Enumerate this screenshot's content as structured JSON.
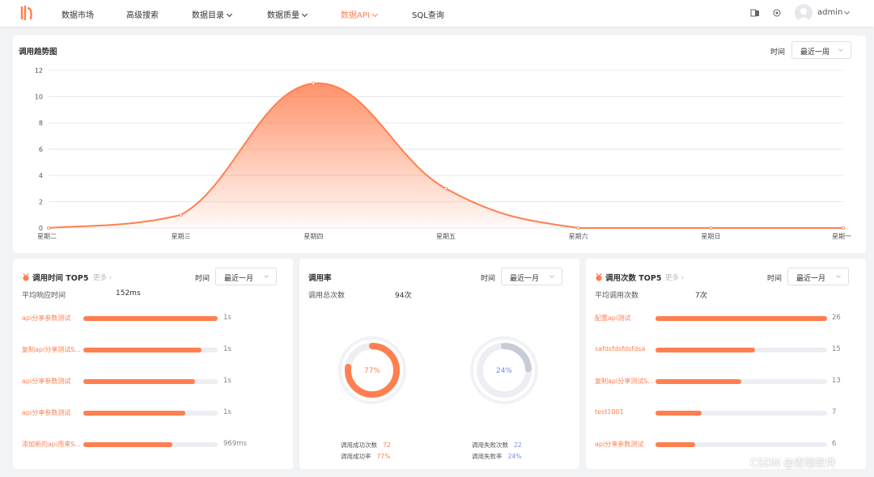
{
  "nav": {
    "items": [
      {
        "label": "数据市场",
        "has_caret": false,
        "active": false
      },
      {
        "label": "高级搜索",
        "has_caret": false,
        "active": false
      },
      {
        "label": "数据目录",
        "has_caret": true,
        "active": false
      },
      {
        "label": "数据质量",
        "has_caret": true,
        "active": false
      },
      {
        "label": "数据API",
        "has_caret": true,
        "active": true
      },
      {
        "label": "SQL查询",
        "has_caret": false,
        "active": false
      }
    ],
    "icons": [
      "translate-icon",
      "settings-icon"
    ],
    "user": {
      "name": "admin"
    }
  },
  "trend": {
    "title": "调用趋势图",
    "time_label": "时间",
    "time_select": "最近一周"
  },
  "chart_data": {
    "type": "area",
    "title": "调用趋势图",
    "categories": [
      "星期二",
      "星期三",
      "星期四",
      "星期五",
      "星期六",
      "星期日",
      "星期一"
    ],
    "values": [
      0,
      1,
      11,
      3,
      0,
      0,
      0
    ],
    "y_ticks": [
      "0",
      "2",
      "4",
      "6",
      "8",
      "10",
      "12"
    ],
    "ylim": [
      0,
      12
    ],
    "grid": true,
    "smooth": true,
    "color": "#ff7f50"
  },
  "time_top5": {
    "title": "调用时间 TOP5",
    "more": "更多",
    "time_label": "时间",
    "time_select": "最近一月",
    "avg_label": "平均响应时间",
    "avg_value": "152ms",
    "items": [
      {
        "name": "api分享参数测试",
        "value": "1s",
        "ratio": 1.0
      },
      {
        "name": "复制api分享测试S...",
        "value": "1s",
        "ratio": 0.88
      },
      {
        "name": "api分享参数测试",
        "value": "1s",
        "ratio": 0.83
      },
      {
        "name": "api分享参数测试",
        "value": "1s",
        "ratio": 0.76
      },
      {
        "name": "添加新的api用来S...",
        "value": "969ms",
        "ratio": 0.66
      }
    ]
  },
  "rate": {
    "title": "调用率",
    "time_label": "时间",
    "time_select": "最近一月",
    "total_label": "调用总次数",
    "total_value": "94次",
    "success": {
      "percent": 77,
      "label": "77%",
      "count_label": "调用成功次数",
      "count": "72",
      "rate_label": "调用成功率",
      "rate": "77%",
      "color": "#ff7f50"
    },
    "fail": {
      "percent": 24,
      "label": "24%",
      "count_label": "调用失败次数",
      "count": "22",
      "rate_label": "调用失败率",
      "rate": "24%",
      "color": "#c8ccd6"
    }
  },
  "count_top5": {
    "title": "调用次数 TOP5",
    "more": "更多",
    "time_label": "时间",
    "time_select": "最近一月",
    "avg_label": "平均调用次数",
    "avg_value": "7次",
    "items": [
      {
        "name": "配置api测试",
        "value": "26",
        "ratio": 1.0
      },
      {
        "name": "safdsfdsfdsfdsa",
        "value": "15",
        "ratio": 0.58
      },
      {
        "name": "复制api分享测试S...",
        "value": "13",
        "ratio": 0.5
      },
      {
        "name": "test1001",
        "value": "7",
        "ratio": 0.27
      },
      {
        "name": "api分享参数测试",
        "value": "6",
        "ratio": 0.23
      }
    ]
  },
  "watermark": "CSDN @麦聪软件"
}
